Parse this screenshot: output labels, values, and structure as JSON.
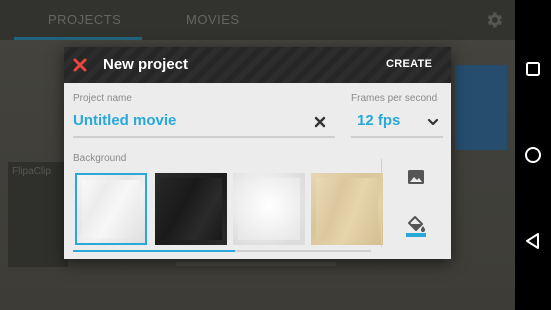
{
  "background_app": {
    "tabs": [
      "PROJECTS",
      "MOVIES"
    ],
    "card_label": "FlipaClip",
    "gear_icon": "settings-gear-icon"
  },
  "dialog": {
    "title": "New project",
    "create_label": "CREATE",
    "close_icon": "close-x-icon",
    "project_name_label": "Project name",
    "project_name_value": "Untitled movie",
    "clear_icon": "clear-x-icon",
    "fps_label": "Frames per second",
    "fps_value": "12 fps",
    "fps_chevron_icon": "chevron-down-icon",
    "background_label": "Background",
    "backgrounds": [
      "crumpled-white-paper",
      "black-paper",
      "white-paper",
      "parchment"
    ],
    "selected_background": 0,
    "image_button_icon": "image-icon",
    "fill_button_icon": "paint-bucket-icon"
  },
  "navbar": {
    "recents_icon": "square-icon",
    "home_icon": "circle-icon",
    "back_icon": "triangle-back-icon"
  },
  "colors": {
    "accent": "#29a8d9",
    "close_red": "#e8473f",
    "header": "#262626",
    "dialog_bg": "#ececec"
  }
}
